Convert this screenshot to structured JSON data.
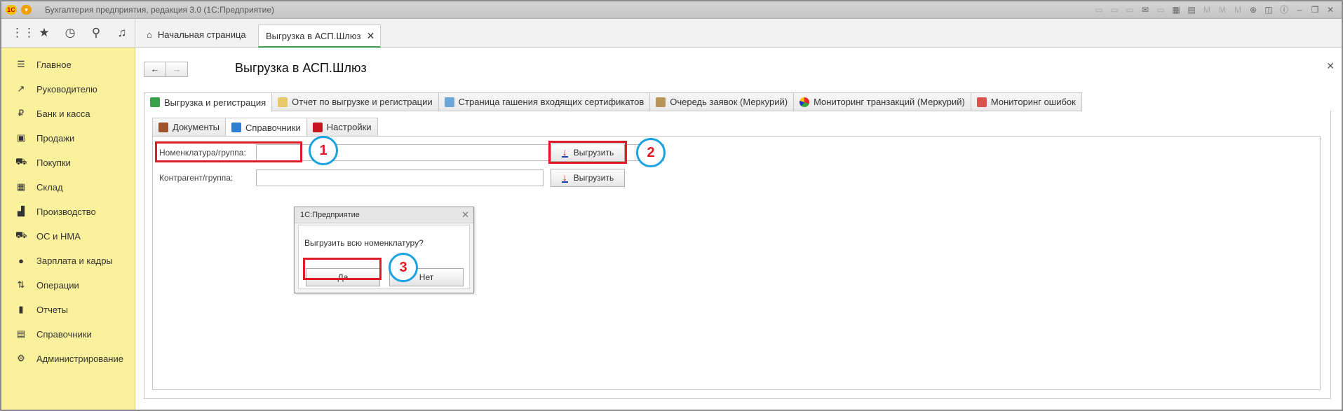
{
  "window": {
    "title": "Бухгалтерия предприятия, редакция 3.0  (1С:Предприятие)"
  },
  "open_tabs": [
    {
      "label": "Начальная страница"
    },
    {
      "label": "Выгрузка в АСП.Шлюз"
    }
  ],
  "sidebar": {
    "items": [
      {
        "label": "Главное"
      },
      {
        "label": "Руководителю"
      },
      {
        "label": "Банк и касса"
      },
      {
        "label": "Продажи"
      },
      {
        "label": "Покупки"
      },
      {
        "label": "Склад"
      },
      {
        "label": "Производство"
      },
      {
        "label": "ОС и НМА"
      },
      {
        "label": "Зарплата и кадры"
      },
      {
        "label": "Операции"
      },
      {
        "label": "Отчеты"
      },
      {
        "label": "Справочники"
      },
      {
        "label": "Администрирование"
      }
    ]
  },
  "page": {
    "title": "Выгрузка в АСП.Шлюз"
  },
  "outer_tabs": [
    {
      "label": "Выгрузка и регистрация"
    },
    {
      "label": "Отчет по выгрузке и регистрации"
    },
    {
      "label": "Страница гашения входящих сертификатов"
    },
    {
      "label": "Очередь заявок (Меркурий)"
    },
    {
      "label": "Мониторинг транзакций (Меркурий)"
    },
    {
      "label": "Мониторинг ошибок"
    }
  ],
  "inner_tabs": [
    {
      "label": "Документы"
    },
    {
      "label": "Справочники"
    },
    {
      "label": "Настройки"
    }
  ],
  "form": {
    "nomenclature_label": "Номенклатура/группа:",
    "nomenclature_value": "",
    "contractor_label": "Контрагент/группа:",
    "contractor_value": "",
    "export_label": "Выгрузить"
  },
  "dialog": {
    "title": "1С:Предприятие",
    "message": "Выгрузить всю номенклатуру?",
    "yes": "Да",
    "no": "Нет"
  },
  "markers": [
    "1",
    "2",
    "3"
  ],
  "colors": {
    "sidebar_bg": "#fbf09c",
    "highlight_red": "#e01b24",
    "marker_blue": "#1aa3e0",
    "active_tab_green": "#3aa14a"
  }
}
